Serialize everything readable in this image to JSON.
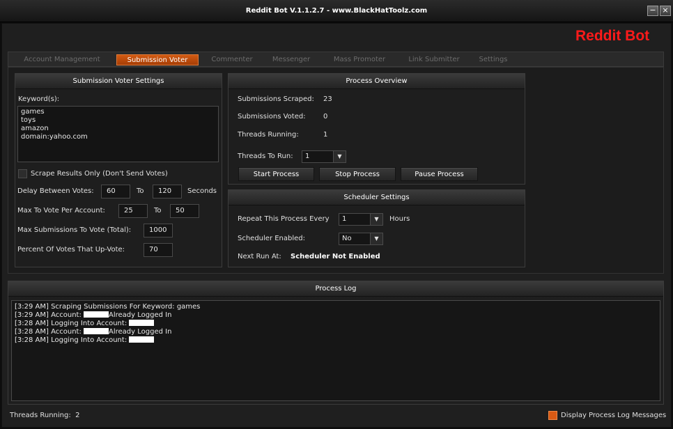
{
  "window": {
    "title": "Reddit Bot V.1.1.2.7 - www.BlackHatToolz.com",
    "minimize": "−",
    "close": "×"
  },
  "brand": "Reddit Bot",
  "tabs": [
    "Account Management",
    "Submission Voter",
    "Commenter",
    "Messenger",
    "Mass Promoter",
    "Link Submitter",
    "Settings"
  ],
  "active_tab": "Submission Voter",
  "voter_settings": {
    "title": "Submission Voter Settings",
    "keywords_label": "Keyword(s):",
    "keywords": [
      "games",
      "toys",
      "amazon",
      "domain:yahoo.com"
    ],
    "scrape_only_label": "Scrape Results Only (Don't Send Votes)",
    "delay_label": "Delay Between Votes:",
    "delay_min": "60",
    "to_label": "To",
    "delay_max": "120",
    "seconds_label": "Seconds",
    "max_vote_label": "Max To Vote  Per Account:",
    "max_vote_min": "25",
    "to_label2": "To",
    "max_vote_max": "50",
    "max_total_label": "Max Submissions To Vote (Total):",
    "max_total": "1000",
    "percent_label": "Percent Of Votes That Up-Vote:",
    "percent": "70"
  },
  "process_overview": {
    "title": "Process Overview",
    "scraped_label": "Submissions Scraped:",
    "scraped": "23",
    "voted_label": "Submissions Voted:",
    "voted": "0",
    "threads_running_label": "Threads Running:",
    "threads_running": "1",
    "threads_to_run_label": "Threads To Run:",
    "threads_to_run": "1",
    "start_button": "Start Process",
    "stop_button": "Stop Process",
    "pause_button": "Pause Process"
  },
  "scheduler": {
    "title": "Scheduler Settings",
    "repeat_label": "Repeat This Process Every",
    "repeat_value": "1",
    "hours_label": "Hours",
    "enabled_label": "Scheduler Enabled:",
    "enabled_value": "No",
    "next_run_label": "Next Run At:",
    "next_run_value": "Scheduler Not Enabled"
  },
  "log": {
    "title": "Process Log",
    "lines": [
      {
        "prefix": "[3:29 AM] Scraping Submissions For Keyword: games",
        "redacted": false,
        "suffix": ""
      },
      {
        "prefix": "[3:29 AM] Account: ",
        "redacted": true,
        "suffix": "Already Logged In"
      },
      {
        "prefix": "[3:28 AM] Logging Into Account: ",
        "redacted": true,
        "suffix": ""
      },
      {
        "prefix": "[3:28 AM] Account: ",
        "redacted": true,
        "suffix": "Already Logged In"
      },
      {
        "prefix": "[3:28 AM] Logging Into Account: ",
        "redacted": true,
        "suffix": ""
      }
    ]
  },
  "status": {
    "threads_running_label": "Threads Running:",
    "threads_running": "2",
    "display_log_label": "Display Process Log Messages"
  },
  "colors": {
    "accent": "#d95a14",
    "brand": "#ff1a1a",
    "background": "#1f1f1f"
  }
}
